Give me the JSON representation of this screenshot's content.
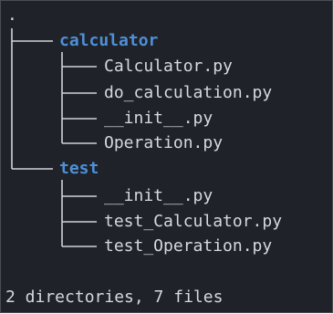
{
  "tree": {
    "root": ".",
    "directories": [
      {
        "name": "calculator",
        "files": [
          "Calculator.py",
          "do_calculation.py",
          "__init__.py",
          "Operation.py"
        ]
      },
      {
        "name": "test",
        "files": [
          "__init__.py",
          "test_Calculator.py",
          "test_Operation.py"
        ]
      }
    ],
    "summary": "2 directories, 7 files"
  },
  "colors": {
    "background": "#1f2329",
    "text": "#d6d8dc",
    "directory": "#4f8fd6",
    "tree_lines": "#d0d2d6"
  }
}
